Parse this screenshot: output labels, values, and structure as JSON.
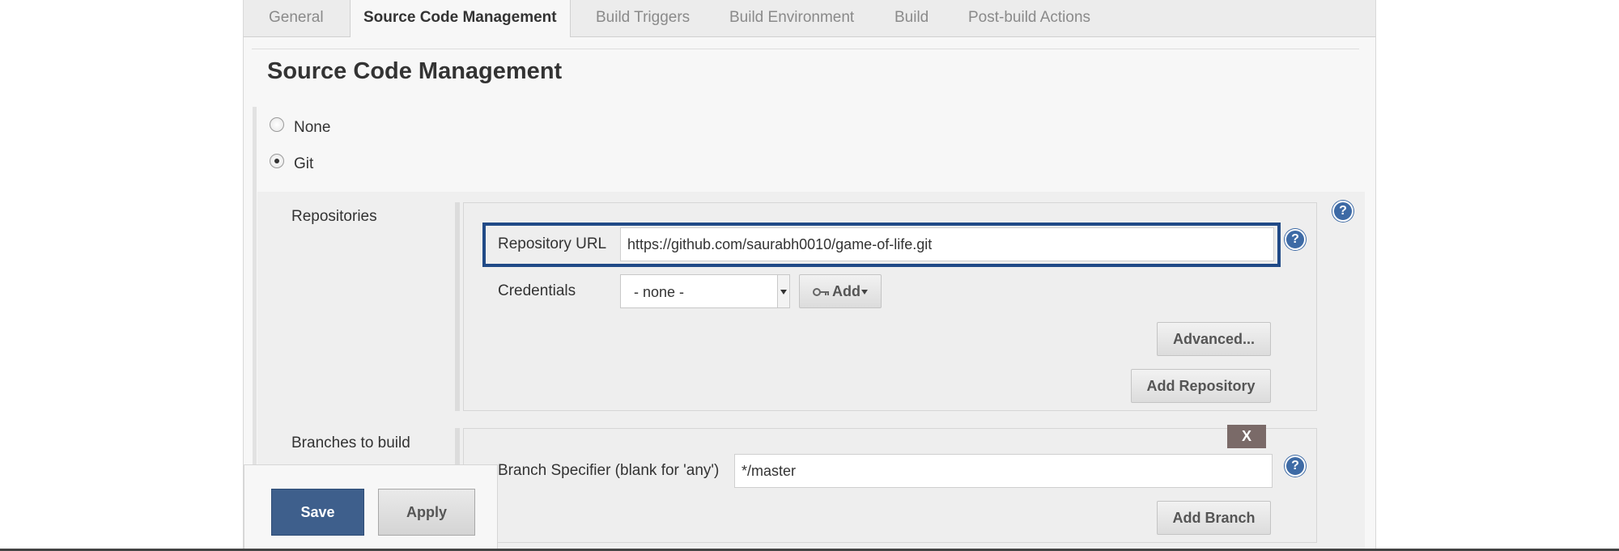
{
  "tabs": [
    {
      "label": "General",
      "active": false
    },
    {
      "label": "Source Code Management",
      "active": true
    },
    {
      "label": "Build Triggers",
      "active": false
    },
    {
      "label": "Build Environment",
      "active": false
    },
    {
      "label": "Build",
      "active": false
    },
    {
      "label": "Post-build Actions",
      "active": false
    }
  ],
  "section_title": "Source Code Management",
  "scm_options": [
    {
      "label": "None",
      "selected": false
    },
    {
      "label": "Git",
      "selected": true
    }
  ],
  "repositories": {
    "label": "Repositories",
    "repository_url_label": "Repository URL",
    "repository_url_value": "https://github.com/saurabh0010/game-of-life.git",
    "credentials_label": "Credentials",
    "credentials_value": "- none -",
    "add_label": "Add",
    "add_icon": "key-icon",
    "advanced_label": "Advanced...",
    "add_repository_label": "Add Repository"
  },
  "branches": {
    "label": "Branches to build",
    "delete_label": "X",
    "branch_specifier_label": "Branch Specifier (blank for 'any')",
    "branch_specifier_value": "*/master",
    "add_branch_label": "Add Branch"
  },
  "help_icon": "?",
  "footer": {
    "save_label": "Save",
    "apply_label": "Apply"
  },
  "colors": {
    "focus_border": "#204a87",
    "save_button": "#3e5f8c",
    "help_icon": "#3d6aa5",
    "delete_button": "#7a6a68"
  }
}
